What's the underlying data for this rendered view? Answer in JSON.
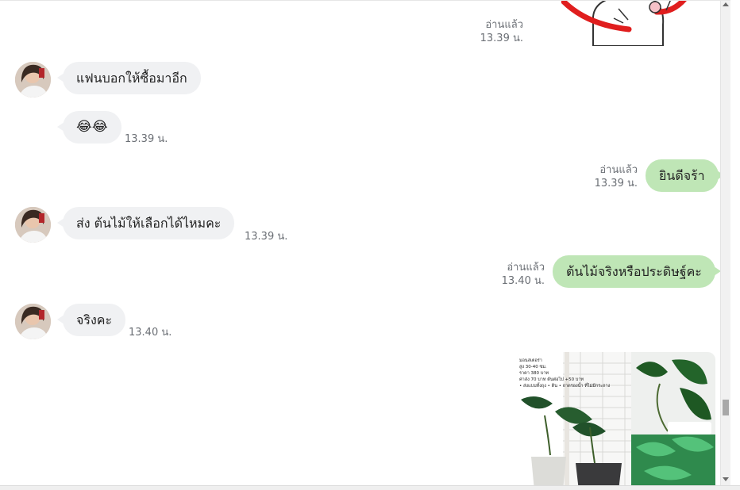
{
  "sticker_message": {
    "read_label": "อ่านแล้ว",
    "time": "13.39 น.",
    "sticker_icon": "cartoon-sticker"
  },
  "messages": [
    {
      "text": "แฟนบอกให้ซื้อมาอีก"
    },
    {
      "text": "😂😂",
      "time": "13.39 น."
    },
    {
      "text": "ยินดีจร้า",
      "read_label": "อ่านแล้ว",
      "time": "13.39 น."
    },
    {
      "text": "ส่ง ต้นไม้ให้เลือกได้ไหมคะ",
      "time": "13.39 น."
    },
    {
      "text": "ต้นไม้จริงหรือประดิษฐ์คะ",
      "read_label": "อ่านแล้ว",
      "time": "13.40 น."
    },
    {
      "text": "จริงคะ",
      "time": "13.40 น."
    }
  ],
  "image_message": {
    "caption_lines": [
      "มอนสเตอร่า",
      "สูง 30-40 ซม.",
      "ราคา 380 บาท",
      "ค่าส่ง 70 บาท ต้นต่อไป +50 บาท",
      "• ส่งแบบทั้งถุง • ดิน • ถาดรองน้ำ ที่ไม่มีกระถาง"
    ]
  },
  "colors": {
    "incoming_bubble": "#f0f1f3",
    "outgoing_bubble": "#bfe6b6",
    "meta_text": "#6b6f75"
  }
}
